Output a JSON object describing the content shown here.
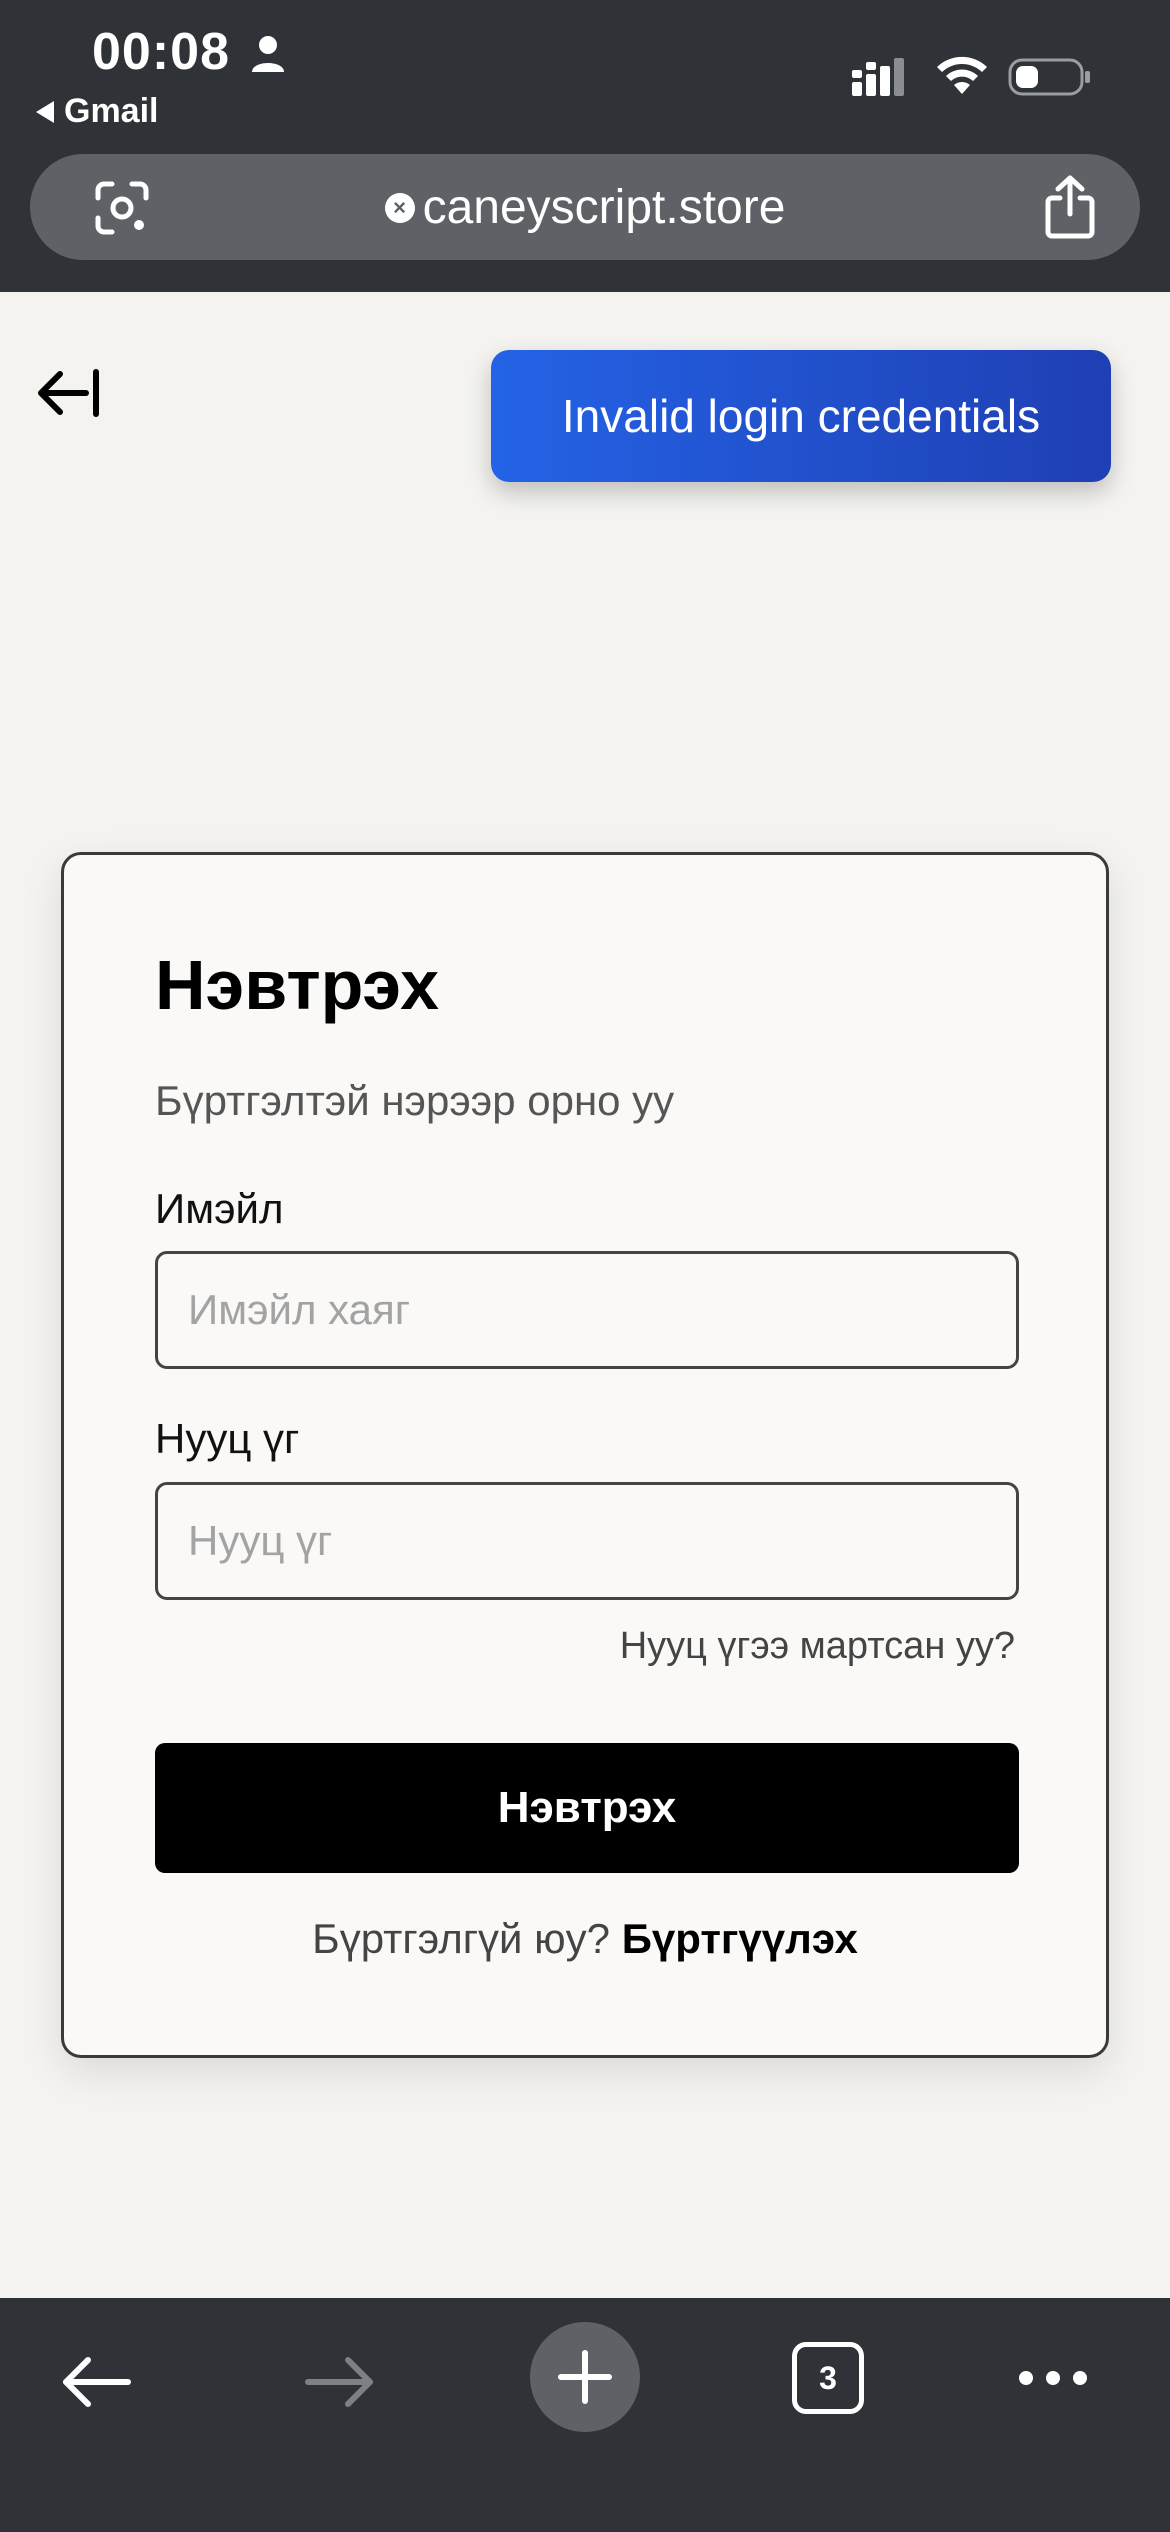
{
  "status_bar": {
    "time": "00:08",
    "back_app": "Gmail"
  },
  "url_bar": {
    "url": "caneyscript.store"
  },
  "toast": {
    "message": "Invalid login credentials"
  },
  "login_card": {
    "title": "Нэвтрэх",
    "subtitle": "Бүртгэлтэй нэрээр орно уу",
    "email_label": "Имэйл",
    "email_placeholder": "Имэйл хаяг",
    "email_value": "",
    "password_label": "Нууц үг",
    "password_placeholder": "Нууц үг",
    "password_value": "",
    "forgot_password": "Нууц үгээ мартсан уу?",
    "submit_label": "Нэвтрэх",
    "signup_prompt": "Бүртгэлгүй юу?",
    "signup_link": "Бүртгүүлэх"
  },
  "bottom_toolbar": {
    "tab_count": "3"
  },
  "colors": {
    "toast_start": "#2463e6",
    "toast_end": "#1f3fb4",
    "browser_chrome": "#2f3237",
    "submit_bg": "#000000"
  }
}
